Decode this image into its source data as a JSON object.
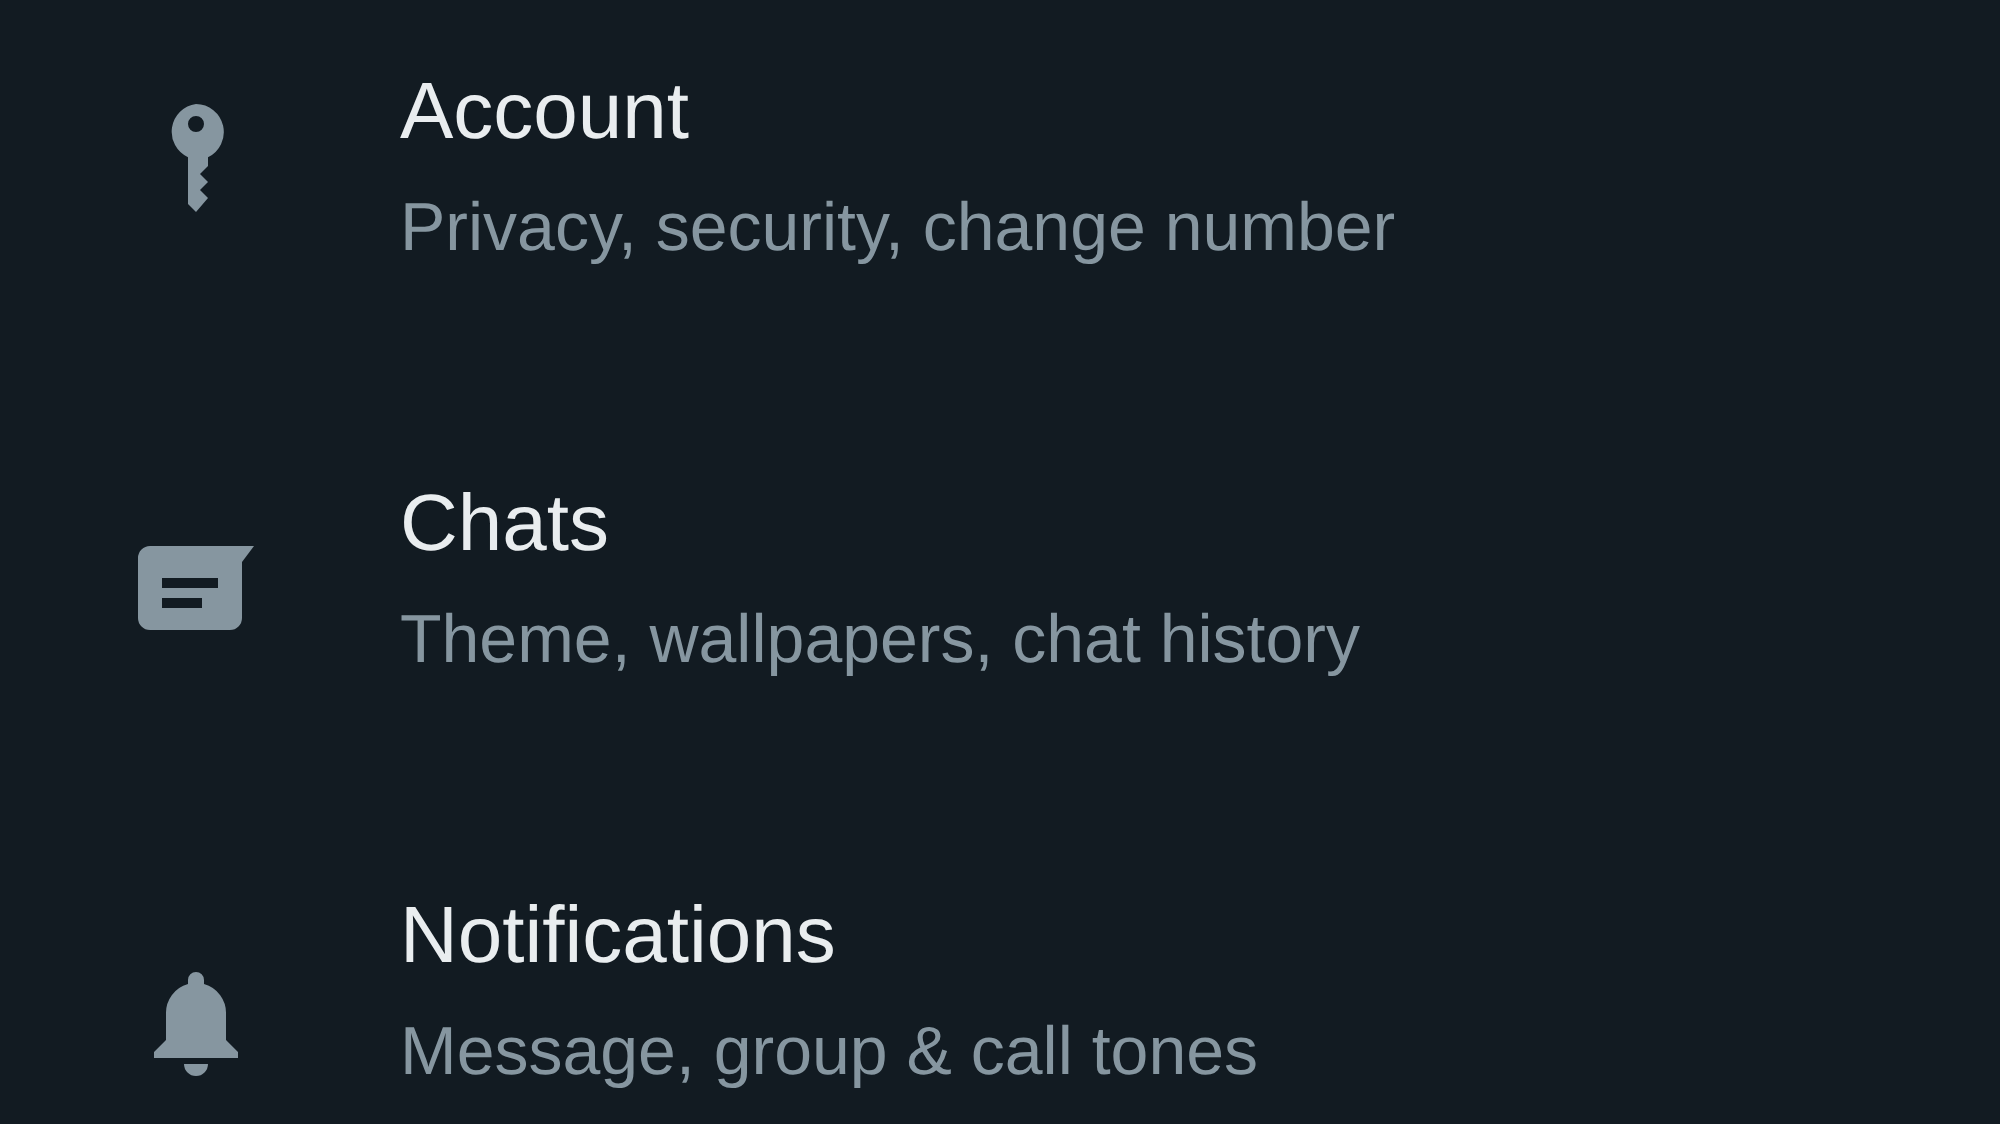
{
  "settings_items": [
    {
      "kind": "key",
      "title": "Account",
      "subtitle": "Privacy, security, change number"
    },
    {
      "kind": "chat",
      "title": "Chats",
      "subtitle": "Theme, wallpapers, chat history"
    },
    {
      "kind": "bell",
      "title": "Notifications",
      "subtitle": "Message, group & call tones"
    }
  ]
}
